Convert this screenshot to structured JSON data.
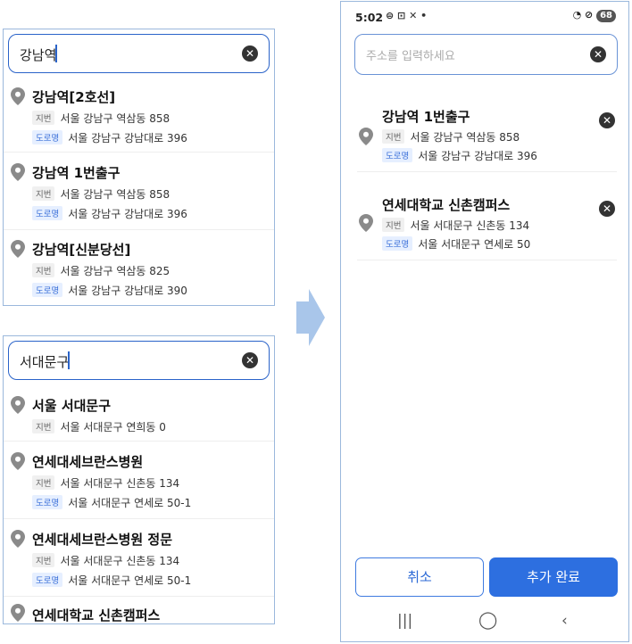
{
  "left_top": {
    "search_value": "강남역",
    "results": [
      {
        "title": "강남역[2호선]",
        "jibun_tag": "지번",
        "jibun": "서울 강남구 역삼동 858",
        "road_tag": "도로명",
        "road": "서울 강남구 강남대로 396"
      },
      {
        "title": "강남역 1번출구",
        "jibun_tag": "지번",
        "jibun": "서울 강남구 역삼동 858",
        "road_tag": "도로명",
        "road": "서울 강남구 강남대로 396"
      },
      {
        "title": "강남역[신분당선]",
        "jibun_tag": "지번",
        "jibun": "서울 강남구 역삼동 825",
        "road_tag": "도로명",
        "road": "서울 강남구 강남대로 390"
      }
    ]
  },
  "left_bottom": {
    "search_value": "서대문구",
    "results": [
      {
        "title": "서울 서대문구",
        "jibun_tag": "지번",
        "jibun": "서울 서대문구 연희동 0"
      },
      {
        "title": "연세대세브란스병원",
        "jibun_tag": "지번",
        "jibun": "서울 서대문구 신촌동 134",
        "road_tag": "도로명",
        "road": "서울 서대문구 연세로 50-1"
      },
      {
        "title": "연세대세브란스병원 정문",
        "jibun_tag": "지번",
        "jibun": "서울 서대문구 신촌동 134",
        "road_tag": "도로명",
        "road": "서울 서대문구 연세로 50-1"
      },
      {
        "title": "연세대학교 신촌캠퍼스"
      }
    ]
  },
  "phone": {
    "status": {
      "time": "5:02",
      "battery": "68"
    },
    "search_placeholder": "주소를 입력하세요",
    "selected": [
      {
        "title": "강남역 1번출구",
        "jibun_tag": "지번",
        "jibun": "서울 강남구 역삼동 858",
        "road_tag": "도로명",
        "road": "서울 강남구 강남대로 396"
      },
      {
        "title": "연세대학교 신촌캠퍼스",
        "jibun_tag": "지번",
        "jibun": "서울 서대문구 신촌동 134",
        "road_tag": "도로명",
        "road": "서울 서대문구 연세로 50"
      }
    ],
    "cancel_label": "취소",
    "done_label": "추가 완료"
  },
  "colors": {
    "accent": "#2d6fe0",
    "arrow": "#a9c6ea",
    "panel_border": "#9bb8dc"
  }
}
